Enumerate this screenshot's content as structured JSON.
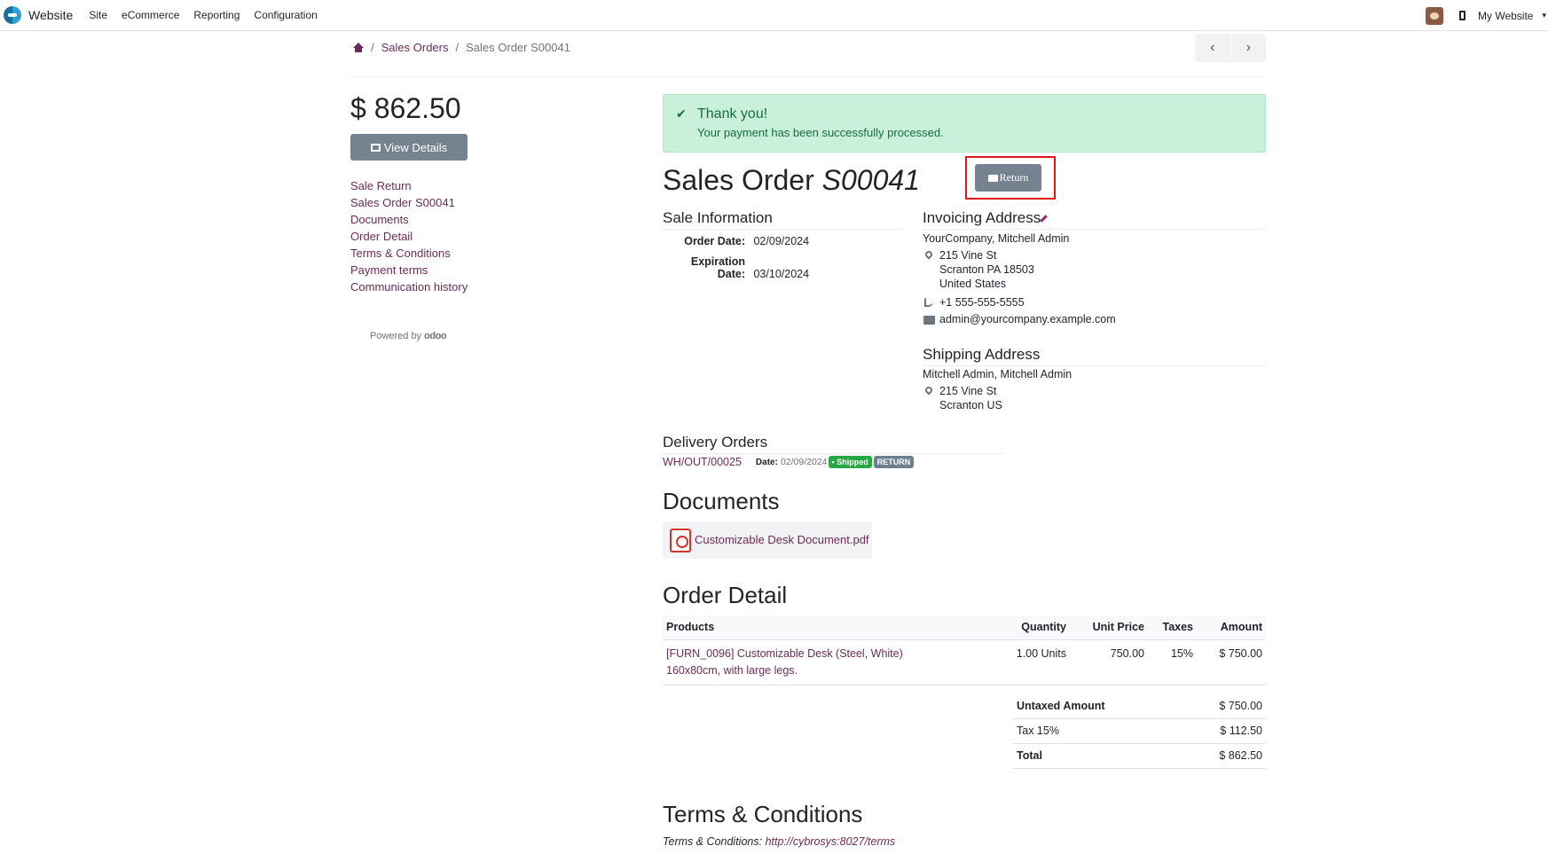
{
  "navbar": {
    "app_name": "Website",
    "menu": [
      "Site",
      "eCommerce",
      "Reporting",
      "Configuration"
    ],
    "website_switcher": "My Website"
  },
  "breadcrumb": {
    "parent": "Sales Orders",
    "current": "Sales Order S00041"
  },
  "sidebar": {
    "total": "$ 862.50",
    "view_details_label": "View Details",
    "toc": [
      "Sale Return",
      "Sales Order S00041",
      "Documents",
      "Order Detail",
      "Terms & Conditions",
      "Payment terms",
      "Communication history"
    ],
    "powered_by": "Powered by",
    "powered_brand": "odoo"
  },
  "alert": {
    "title": "Thank you!",
    "message": "Your payment has been successfully processed."
  },
  "order": {
    "title_prefix": "Sales Order",
    "number": "S00041",
    "return_label": "Return"
  },
  "sale_info": {
    "heading": "Sale Information",
    "order_date_label": "Order Date:",
    "order_date": "02/09/2024",
    "expiration_date_label": "Expiration Date:",
    "expiration_date": "03/10/2024"
  },
  "invoicing": {
    "heading": "Invoicing Address",
    "name": "YourCompany, Mitchell Admin",
    "street": "215 Vine St",
    "city": "Scranton PA 18503",
    "country": "United States",
    "phone": "+1 555-555-5555",
    "email": "admin@yourcompany.example.com"
  },
  "shipping": {
    "heading": "Shipping Address",
    "name": "Mitchell Admin, Mitchell Admin",
    "street": "215 Vine St",
    "city": "Scranton US"
  },
  "delivery": {
    "heading": "Delivery Orders",
    "reference": "WH/OUT/00025",
    "date_label": "Date:",
    "date": "02/09/2024",
    "status_badge": "Shipped",
    "return_badge": "RETURN",
    "colors": {
      "shipped": "#28a745",
      "return": "#6c8090"
    }
  },
  "documents": {
    "heading": "Documents",
    "file_name": "Customizable Desk Document.pdf"
  },
  "order_detail": {
    "heading": "Order Detail",
    "columns": [
      "Products",
      "Quantity",
      "Unit Price",
      "Taxes",
      "Amount"
    ],
    "rows": [
      {
        "product": "[FURN_0096] Customizable Desk (Steel, White)",
        "description": "160x80cm, with large legs.",
        "quantity": "1.00 Units",
        "unit_price": "750.00",
        "taxes": "15%",
        "amount": "$ 750.00"
      }
    ],
    "totals": [
      {
        "label": "Untaxed Amount",
        "value": "$ 750.00"
      },
      {
        "label": "Tax 15%",
        "value": "$ 112.50"
      },
      {
        "label": "Total",
        "value": "$ 862.50"
      }
    ]
  },
  "terms": {
    "heading": "Terms & Conditions",
    "label": "Terms & Conditions:",
    "link": "http://cybrosys:8027/terms"
  },
  "colors": {
    "accent": "#6b2c56",
    "secondary_button": "#758391",
    "alert_bg": "#c9f0da",
    "highlight_frame": "#e0151d"
  }
}
